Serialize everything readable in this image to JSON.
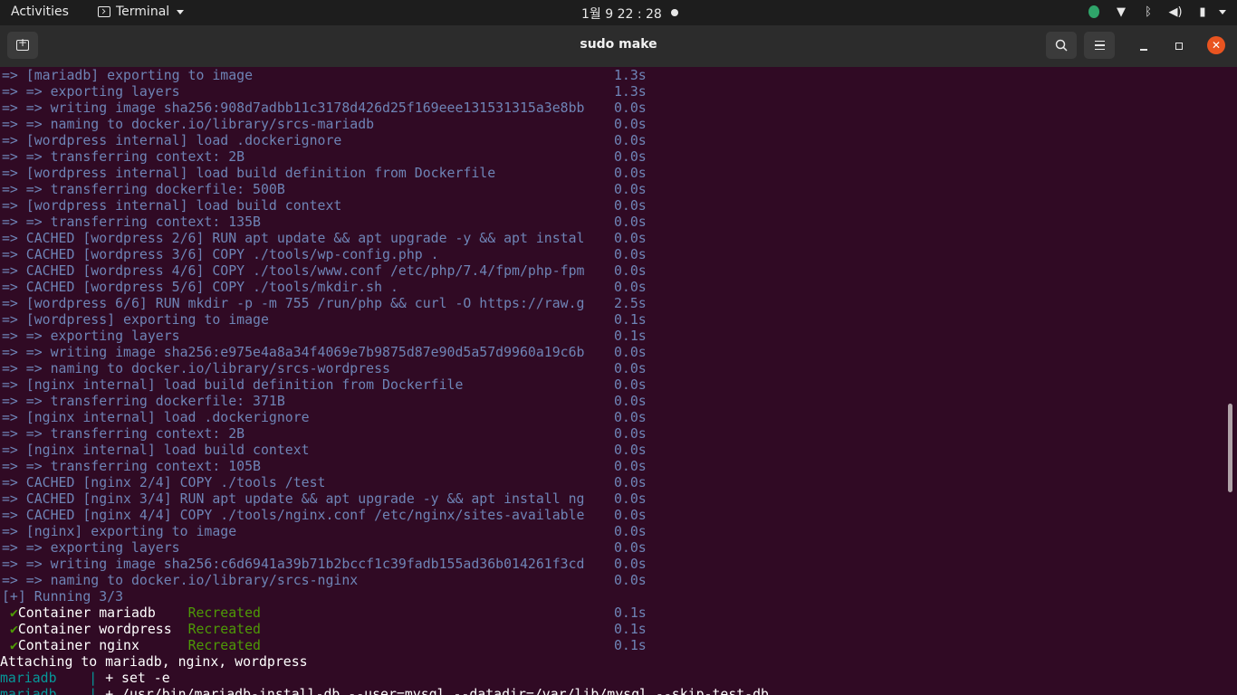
{
  "topbar": {
    "activities": "Activities",
    "app_name": "Terminal",
    "clock": "1월 9  22 : 28"
  },
  "window": {
    "title": "sudo make"
  },
  "terminal": {
    "build_lines": [
      {
        "text": "=> [mariadb] exporting to image",
        "time": "1.3s"
      },
      {
        "text": "=> => exporting layers",
        "time": "1.3s"
      },
      {
        "text": "=> => writing image sha256:908d7adbb11c3178d426d25f169eee131531315a3e8bb",
        "time": "0.0s"
      },
      {
        "text": "=> => naming to docker.io/library/srcs-mariadb",
        "time": "0.0s"
      },
      {
        "text": "=> [wordpress internal] load .dockerignore",
        "time": "0.0s"
      },
      {
        "text": "=> => transferring context: 2B",
        "time": "0.0s"
      },
      {
        "text": "=> [wordpress internal] load build definition from Dockerfile",
        "time": "0.0s"
      },
      {
        "text": "=> => transferring dockerfile: 500B",
        "time": "0.0s"
      },
      {
        "text": "=> [wordpress internal] load build context",
        "time": "0.0s"
      },
      {
        "text": "=> => transferring context: 135B",
        "time": "0.0s"
      },
      {
        "text": "=> CACHED [wordpress 2/6] RUN apt update && apt upgrade -y && apt instal",
        "time": "0.0s"
      },
      {
        "text": "=> CACHED [wordpress 3/6] COPY ./tools/wp-config.php .",
        "time": "0.0s"
      },
      {
        "text": "=> CACHED [wordpress 4/6] COPY ./tools/www.conf /etc/php/7.4/fpm/php-fpm",
        "time": "0.0s"
      },
      {
        "text": "=> CACHED [wordpress 5/6] COPY ./tools/mkdir.sh .",
        "time": "0.0s"
      },
      {
        "text": "=> [wordpress 6/6] RUN mkdir -p -m 755 /run/php && curl -O https://raw.g",
        "time": "2.5s"
      },
      {
        "text": "=> [wordpress] exporting to image",
        "time": "0.1s"
      },
      {
        "text": "=> => exporting layers",
        "time": "0.1s"
      },
      {
        "text": "=> => writing image sha256:e975e4a8a34f4069e7b9875d87e90d5a57d9960a19c6b",
        "time": "0.0s"
      },
      {
        "text": "=> => naming to docker.io/library/srcs-wordpress",
        "time": "0.0s"
      },
      {
        "text": "=> [nginx internal] load build definition from Dockerfile",
        "time": "0.0s"
      },
      {
        "text": "=> => transferring dockerfile: 371B",
        "time": "0.0s"
      },
      {
        "text": "=> [nginx internal] load .dockerignore",
        "time": "0.0s"
      },
      {
        "text": "=> => transferring context: 2B",
        "time": "0.0s"
      },
      {
        "text": "=> [nginx internal] load build context",
        "time": "0.0s"
      },
      {
        "text": "=> => transferring context: 105B",
        "time": "0.0s"
      },
      {
        "text": "=> CACHED [nginx 2/4] COPY ./tools /test",
        "time": "0.0s"
      },
      {
        "text": "=> CACHED [nginx 3/4] RUN apt update && apt upgrade -y && apt install ng",
        "time": "0.0s"
      },
      {
        "text": "=> CACHED [nginx 4/4] COPY ./tools/nginx.conf /etc/nginx/sites-available",
        "time": "0.0s"
      },
      {
        "text": "=> [nginx] exporting to image",
        "time": "0.0s"
      },
      {
        "text": "=> => exporting layers",
        "time": "0.0s"
      },
      {
        "text": "=> => writing image sha256:c6d6941a39b71b2bccf1c39fadb155ad36b014261f3cd",
        "time": "0.0s"
      },
      {
        "text": "=> => naming to docker.io/library/srcs-nginx",
        "time": "0.0s"
      }
    ],
    "running": "[+] Running 3/3",
    "containers": [
      {
        "check": "✔",
        "name": "Container mariadb  ",
        "status": "Recreated",
        "time": "0.1s"
      },
      {
        "check": "✔",
        "name": "Container wordpress",
        "status": "Recreated",
        "time": "0.1s"
      },
      {
        "check": "✔",
        "name": "Container nginx    ",
        "status": "Recreated",
        "time": "0.1s"
      }
    ],
    "attaching": "Attaching to mariadb, nginx, wordpress",
    "logs": [
      {
        "prefix": "mariadb    | ",
        "text": "+ set -e"
      },
      {
        "prefix": "mariadb    | ",
        "text": "+ /usr/bin/mariadb-install-db --user=mysql --datadir=/var/lib/mysql --skip-test-db"
      }
    ]
  },
  "colors": {
    "background": "#300a24",
    "build_text": "#6e84b6",
    "status_green": "#4e9a06",
    "log_prefix": "#06989a"
  }
}
